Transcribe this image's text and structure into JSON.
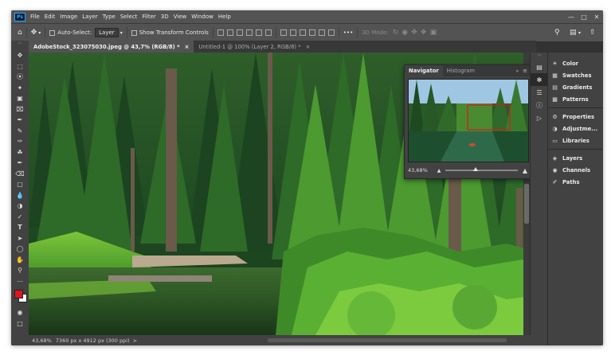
{
  "menubar": {
    "logo": "Ps",
    "items": [
      "File",
      "Edit",
      "Image",
      "Layer",
      "Type",
      "Select",
      "Filter",
      "3D",
      "View",
      "Window",
      "Help"
    ]
  },
  "options": {
    "auto_select_label": "Auto-Select:",
    "layer_dropdown": "Layer",
    "show_transform_label": "Show Transform Controls",
    "mode_3d_label": "3D Mode:",
    "more_label": "•••"
  },
  "tabs": [
    {
      "label": "AdobeStock_323075030.jpeg @ 43,7% (RGB/8) *",
      "close": "×"
    },
    {
      "label": "Untitled-1 @ 100% (Layer 2, RGB/8) *",
      "close": "×"
    }
  ],
  "statusbar": {
    "zoom": "43,68%",
    "doc_info": "7360 px x 4912 px (300 ppi)",
    "arrow": ">"
  },
  "navigator": {
    "tabs": [
      "Navigator",
      "Histogram"
    ],
    "zoom_value": "43,68%"
  },
  "panels": {
    "group1": [
      "Color",
      "Swatches",
      "Gradients",
      "Patterns"
    ],
    "group2": [
      "Properties",
      "Adjustme...",
      "Libraries"
    ],
    "group3": [
      "Layers",
      "Channels",
      "Paths"
    ]
  },
  "colors": {
    "foreground": "#e0161d",
    "background": "#ffffff",
    "accent": "#31a8ff"
  }
}
